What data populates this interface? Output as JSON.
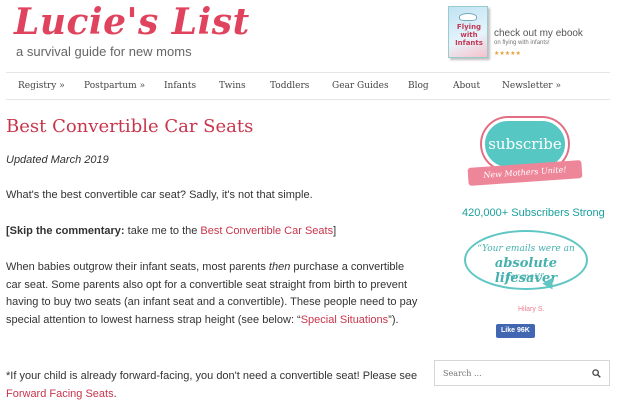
{
  "header": {
    "logo": "Lucie's List",
    "tagline": "a survival guide for new moms"
  },
  "ebook": {
    "cover_title": "Flying with Infants",
    "text": "check out my ebook",
    "subtext": "on flying with infants!",
    "stars": "★★★★★"
  },
  "nav": {
    "items": [
      {
        "label": "Registry »"
      },
      {
        "label": "Postpartum »"
      },
      {
        "label": "Infants"
      },
      {
        "label": "Twins"
      },
      {
        "label": "Toddlers"
      },
      {
        "label": "Gear Guides"
      },
      {
        "label": "Blog"
      },
      {
        "label": "About"
      },
      {
        "label": "Newsletter »"
      }
    ]
  },
  "article": {
    "title": "Best Convertible Car Seats",
    "updated": "Updated March 2019",
    "p1": "What's the best convertible car seat? Sadly, it's not that simple.",
    "p2_bold": "[Skip the commentary:",
    "p2_text": " take me to the ",
    "p2_link": "Best Convertible Car Seats",
    "p2_end": "]",
    "p3_a": "When babies outgrow their infant seats, most parents ",
    "p3_em": "then",
    "p3_b": " purchase a convertible car seat. Some parents also opt for a convertible seat straight from birth to prevent having to buy two seats (an infant seat and a convertible). These people need to pay special attention to lowest harness strap height (see below: “",
    "p3_link": "Special Situations",
    "p3_end": "”).",
    "p4_a": "*If your child is already forward-facing, you don't need a convertible seat! Please see ",
    "p4_link": "Forward Facing Seats",
    "p4_end": "."
  },
  "sidebar": {
    "subscribe": "subscribe",
    "ribbon": "New Mothers Unite!",
    "subscribers": "420,000+ Subscribers Strong",
    "quote_line1": "“Your emails were an",
    "quote_line2": "absolute lifesaver",
    "quote_line3": "for me!!”",
    "quote_author": "Hilary S.",
    "fb_like": "Like 96K",
    "search_placeholder": "Search ..."
  },
  "colors": {
    "brand_pink": "#e0435d",
    "link_red": "#c8354b",
    "teal": "#56c7c3"
  }
}
